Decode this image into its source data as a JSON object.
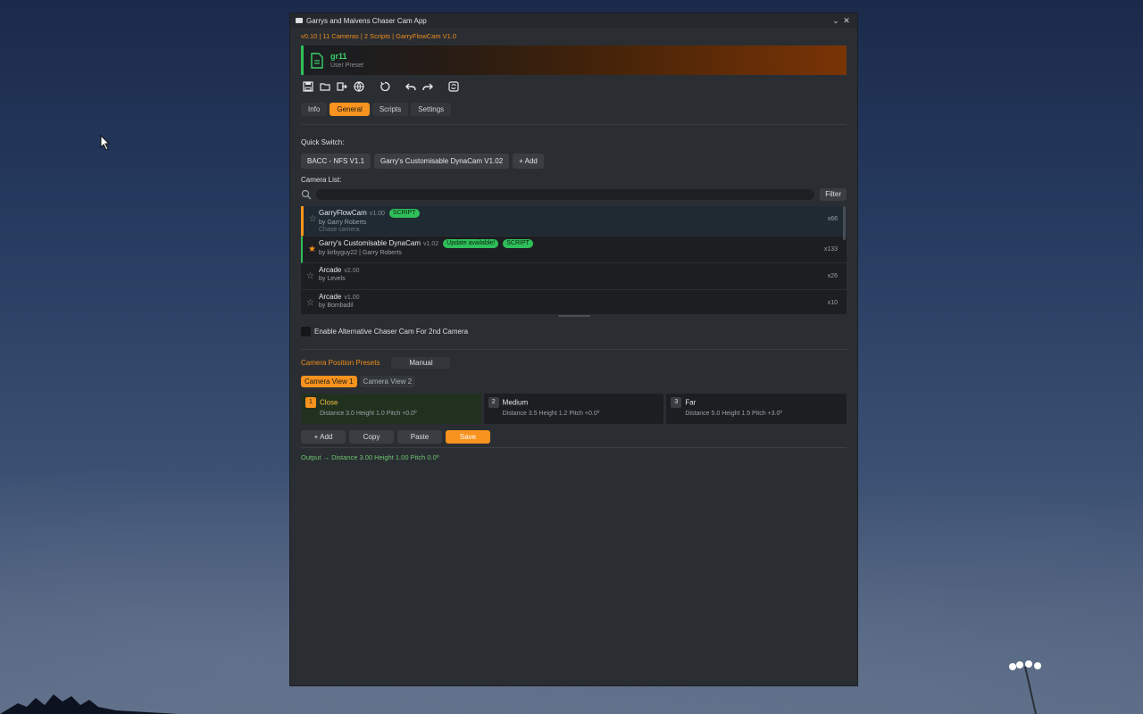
{
  "window": {
    "title": "Garrys and Maivens Chaser Cam App",
    "minimize_glyph": "⌄",
    "close_glyph": "✕"
  },
  "version_line": "v0.10 | 11 Cameras | 2 Scripts | GarryFlowCam V1.0",
  "preset": {
    "name": "gr11",
    "type": "User Preset",
    "accent_color": "#2fbf5a"
  },
  "toolbar": {
    "icons": [
      "save-icon",
      "open-folder-icon",
      "export-icon",
      "globe-icon",
      "reset-icon",
      "undo-icon",
      "redo-icon",
      "refresh-icon"
    ]
  },
  "tabs": [
    {
      "label": "Info"
    },
    {
      "label": "General",
      "active": true
    },
    {
      "label": "Scripts"
    },
    {
      "label": "Settings"
    }
  ],
  "quick_switch": {
    "label": "Quick Switch:",
    "items": [
      "BACC - NFS V1.1",
      "Garry's Customisable DynaCam V1.02"
    ],
    "add_label": "+ Add"
  },
  "camera_list": {
    "label": "Camera List:",
    "filter_label": "Filter",
    "items": [
      {
        "name": "GarryFlowCam",
        "version": "v1.00",
        "author": "by Garry Roberts",
        "description": "Chase camera",
        "badges": [
          "SCRIPT"
        ],
        "count": "x66",
        "starred": false
      },
      {
        "name": "Garry's Customisable DynaCam",
        "version": "v1.02",
        "author": "by kirbyguy22 | Garry Roberts",
        "badges": [
          "Update available!",
          "SCRIPT"
        ],
        "count": "x133",
        "starred": true
      },
      {
        "name": "Arcade",
        "version": "v2.00",
        "author": "by Levels",
        "count": "x26",
        "starred": false
      },
      {
        "name": "Arcade",
        "version": "v1.00",
        "author": "by Bombadil",
        "count": "x10",
        "starred": false
      }
    ]
  },
  "alt_chaser": {
    "label": "Enable Alternative Chaser Cam For 2nd Camera",
    "checked": false
  },
  "position_presets": {
    "label": "Camera Position Presets",
    "mode": "Manual",
    "view_tabs": [
      "Camera View 1",
      "Camera View 2"
    ],
    "cards": [
      {
        "num": "1",
        "name": "Close",
        "params": "Distance 3.0  Height 1.0  Pitch +0.0º"
      },
      {
        "num": "2",
        "name": "Medium",
        "params": "Distance 3.5  Height 1.2  Pitch +0.0º"
      },
      {
        "num": "3",
        "name": "Far",
        "params": "Distance 5.0  Height 1.5  Pitch +3.0º"
      }
    ],
    "actions": [
      "+ Add",
      "Copy",
      "Paste",
      "Save"
    ],
    "output": "Output → Distance 3.00  Height 1.00  Pitch 0.0º"
  },
  "colors": {
    "accent_orange": "#f7931e",
    "accent_green": "#2fbf5a",
    "panel_bg": "#2a2e33"
  }
}
